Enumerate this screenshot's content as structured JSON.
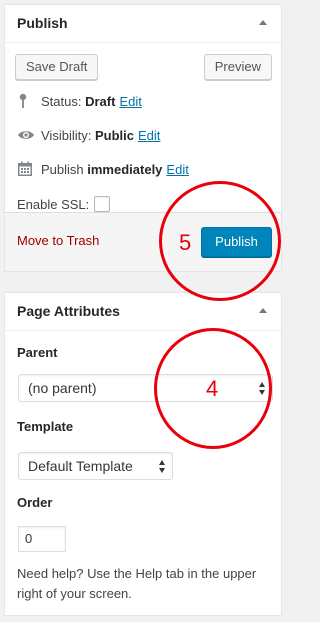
{
  "publish_box": {
    "title": "Publish",
    "save_draft_label": "Save Draft",
    "preview_label": "Preview",
    "status_label": "Status:",
    "status_value": "Draft",
    "visibility_label": "Visibility:",
    "visibility_value": "Public",
    "publish_label": "Publish",
    "publish_value": "immediately",
    "edit_label": "Edit",
    "ssl_label": "Enable SSL:",
    "ssl_checked": false,
    "trash_label": "Move to Trash",
    "publish_button_label": "Publish"
  },
  "page_attributes": {
    "title": "Page Attributes",
    "parent_label": "Parent",
    "parent_value": "(no parent)",
    "template_label": "Template",
    "template_value": "Default Template",
    "order_label": "Order",
    "order_value": "0",
    "help_text": "Need help? Use the Help tab in the upper right of your screen."
  },
  "annotations": {
    "publish_marker": "5",
    "parent_marker": "4",
    "marker_color": "#e8000b"
  },
  "colors": {
    "primary_button": "#0085ba",
    "link": "#0073aa",
    "trash": "#a00000"
  },
  "icons": [
    "pin-icon",
    "eye-icon",
    "calendar-icon",
    "collapse-arrow-icon",
    "select-arrows-icon"
  ]
}
